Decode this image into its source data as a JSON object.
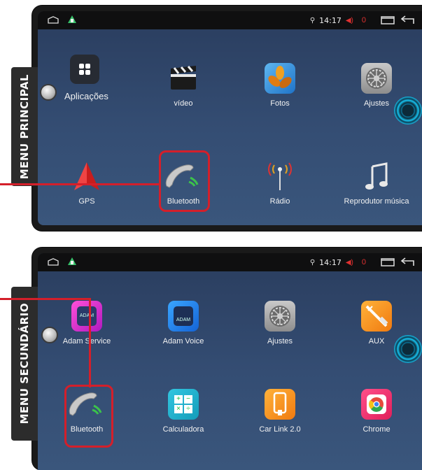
{
  "top": {
    "side_tab": "MENU PRINCIPAL",
    "statusbar": {
      "time": "14:17",
      "count": "0"
    },
    "row1": [
      {
        "label": "Aplicações",
        "icon": "grid-apps-icon"
      },
      {
        "label": "vídeo",
        "icon": "clapperboard-icon"
      },
      {
        "label": "Fotos",
        "icon": "photos-leaf-icon"
      },
      {
        "label": "Ajustes",
        "icon": "settings-gear-icon"
      }
    ],
    "row2": [
      {
        "label": "GPS",
        "icon": "gps-arrow-icon"
      },
      {
        "label": "Bluetooth",
        "icon": "phone-handset-icon"
      },
      {
        "label": "Rádio",
        "icon": "radio-antenna-icon"
      },
      {
        "label": "Reprodutor música",
        "icon": "music-note-icon"
      }
    ]
  },
  "bottom": {
    "side_tab": "MENU SECUNDÁRIO",
    "statusbar": {
      "time": "14:17",
      "count": "0"
    },
    "row1": [
      {
        "label": "Adam Service",
        "icon": "adam-service-icon",
        "badge": "ADAM"
      },
      {
        "label": "Adam Voice",
        "icon": "adam-voice-icon",
        "badge": "ADAM"
      },
      {
        "label": "Ajustes",
        "icon": "settings-gear-icon"
      },
      {
        "label": "AUX",
        "icon": "aux-cable-icon"
      }
    ],
    "row2": [
      {
        "label": "Bluetooth",
        "icon": "phone-handset-icon"
      },
      {
        "label": "Calculadora",
        "icon": "calculator-icon",
        "keys": [
          "+",
          "−",
          "×",
          "÷"
        ]
      },
      {
        "label": "Car Link 2.0",
        "icon": "car-link-phone-icon"
      },
      {
        "label": "Chrome",
        "icon": "chrome-icon"
      }
    ]
  },
  "colors": {
    "highlight": "#d41f2a",
    "screen_bg": "#344d73",
    "statusbar_bg": "#0f0f10"
  }
}
